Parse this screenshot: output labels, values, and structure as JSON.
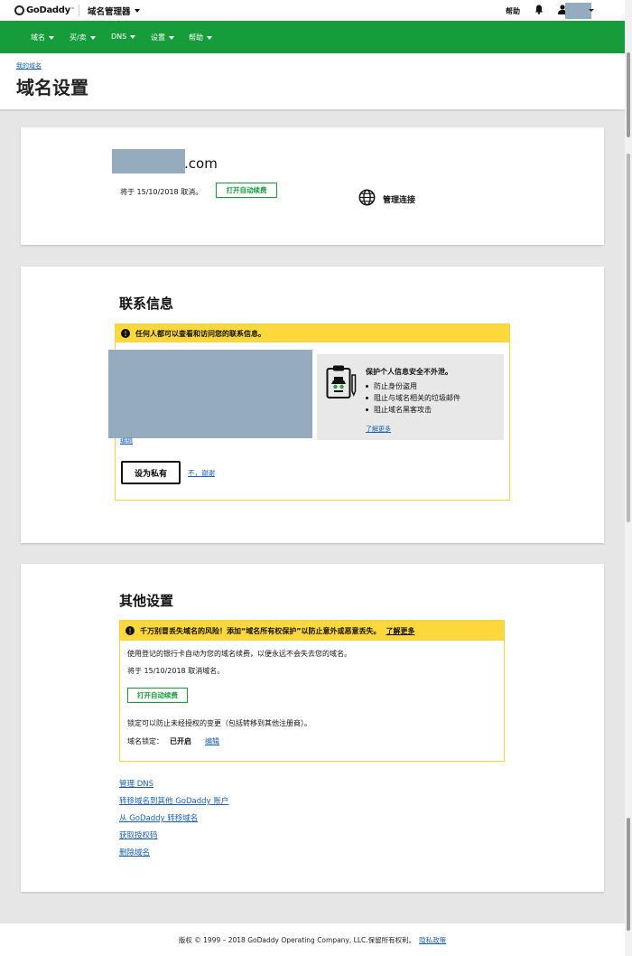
{
  "header": {
    "logo_text": "GoDaddy",
    "logo_tm": "™",
    "app_name": "域名管理器",
    "help": "帮助"
  },
  "nav": {
    "items": [
      {
        "label": "域名"
      },
      {
        "label": "买/卖"
      },
      {
        "label": "DNS"
      },
      {
        "label": "设置"
      },
      {
        "label": "帮助"
      }
    ]
  },
  "title_area": {
    "breadcrumb": "我的域名",
    "title": "域名设置"
  },
  "domain_card": {
    "tld": ".com",
    "cancel_text": "将于 15/10/2018 取消。",
    "auto_renew_button": "打开自动续费",
    "manage_connection": "管理连接"
  },
  "contact_card": {
    "title": "联系信息",
    "warning": "任何人都可以查看和访问您的联系信息。",
    "edit": "编辑",
    "privacy_title": "保护个人信息安全不外泄。",
    "privacy_points": [
      "防止身份盗用",
      "阻止与域名相关的垃圾邮件",
      "阻止域名黑客攻击"
    ],
    "learn_more": "了解更多",
    "make_private_button": "设为私有",
    "no_thanks": "不，谢谢"
  },
  "other_card": {
    "title": "其他设置",
    "warning": "千万别冒丢失域名的风险！添加“域名所有权保护”以防止意外或恶意丢失。",
    "warning_link": "了解更多",
    "renew_desc": "使用登记的银行卡自动为您的域名续费，以便永远不会失去您的域名。",
    "cancel_text": "将于 15/10/2018 取消域名。",
    "auto_renew_button": "打开自动续费",
    "lock_desc": "锁定可以防止未经授权的变更（包括转移到其他注册商）。",
    "lock_label": "域名锁定：",
    "lock_status": "已开启",
    "lock_edit": "编辑",
    "links": [
      "管理 DNS",
      "转移域名到其他 GoDaddy 账户",
      "从 GoDaddy 转移域名",
      "获取授权码",
      "删除域名"
    ]
  },
  "footer": {
    "copyright": "版权 © 1999 – 2018 GoDaddy Operating Company, LLC.保留所有权利。",
    "privacy_link": "隐私政策"
  }
}
